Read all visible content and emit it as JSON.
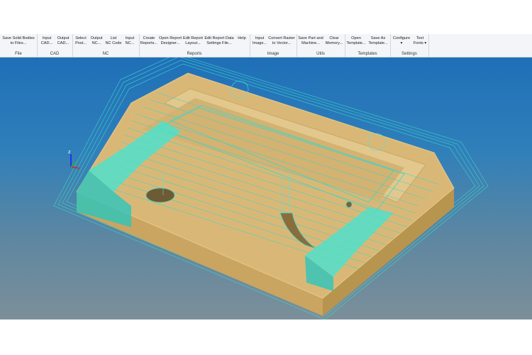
{
  "ribbon": {
    "groups": [
      {
        "caption": "File",
        "buttons": [
          "Save Solid Bodies\nto Files..."
        ]
      },
      {
        "caption": "CAD",
        "buttons": [
          "Input\nCAD...",
          "Output\nCAD..."
        ]
      },
      {
        "caption": "NC",
        "buttons": [
          "Select\nPost...",
          "Output\nNC...",
          "List\nNC Code",
          "Input\nNC..."
        ]
      },
      {
        "caption": "Reports",
        "buttons": [
          "Create\nReports...",
          "Open Report\nDesigner...",
          "Edit Report\nLayout...",
          "Edit Report Data\nSettings File...",
          "Help"
        ]
      },
      {
        "caption": "Image",
        "buttons": [
          "Input\nImage...",
          "Convert Raster\nto Vector..."
        ]
      },
      {
        "caption": "Utils",
        "buttons": [
          "Save Part and\nMachine...",
          "Clear\nMemory..."
        ]
      },
      {
        "caption": "Templates",
        "buttons": [
          "Open\nTemplate...",
          "Save As\nTemplate..."
        ]
      },
      {
        "caption": "Settings",
        "buttons": [
          "Configure\n▾",
          "Text\nFonts ▾"
        ]
      }
    ]
  },
  "viewport": {
    "axis_label": "z",
    "colors": {
      "part_top": "#d9b877",
      "part_side": "#c9a561",
      "part_edge": "#e6c98a",
      "toolpath": "#3ad6c8",
      "toolpath_dense": "#44f0e0",
      "bg_top": "#1f6fb8",
      "bg_bottom": "#7c8f9a"
    }
  }
}
